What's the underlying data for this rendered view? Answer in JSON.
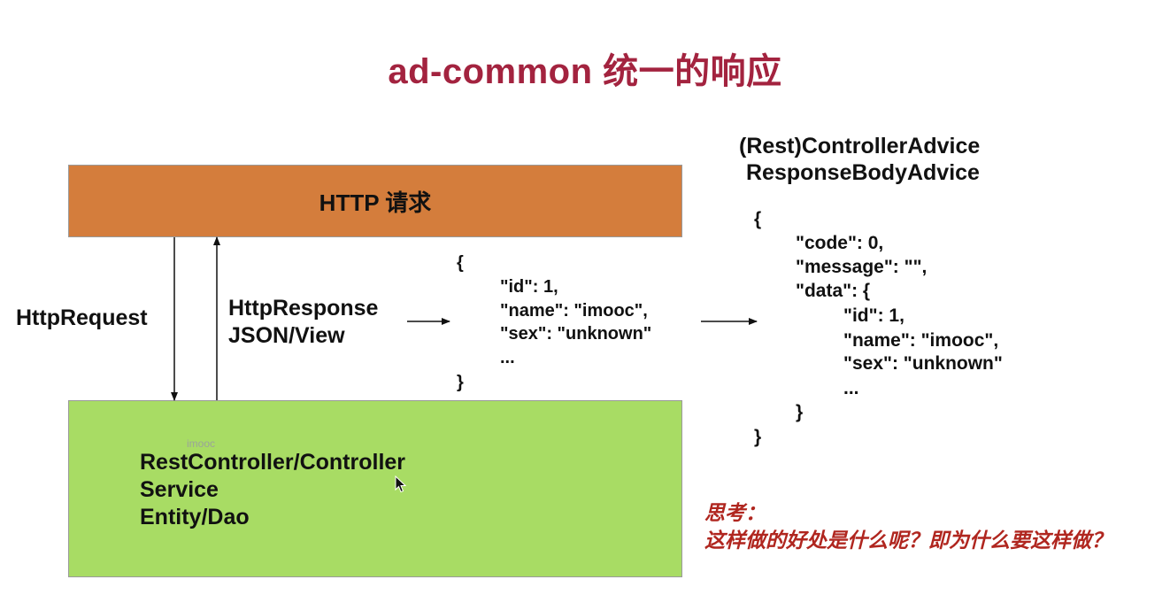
{
  "title": "ad-common 统一的响应",
  "http_box": {
    "label": "HTTP 请求",
    "color": "#d47d3c"
  },
  "backend_box": {
    "color": "#a8dc64",
    "watermark": "imooc",
    "layers": [
      "RestController/Controller",
      "Service",
      "Entity/Dao"
    ]
  },
  "request_label": "HttpRequest",
  "response_labels": [
    "HttpResponse",
    "JSON/View"
  ],
  "raw_json": {
    "open": "{",
    "lines": [
      "\"id\": 1,",
      "\"name\": \"imooc\",",
      "\"sex\": \"unknown\"",
      "..."
    ],
    "close": "}"
  },
  "advice": {
    "line1": "(Rest)ControllerAdvice",
    "line2": "ResponseBodyAdvice"
  },
  "wrapped_json": {
    "open": "{",
    "code": "\"code\": 0,",
    "message": "\"message\": \"\",",
    "data_open": "\"data\": {",
    "data_lines": [
      "\"id\": 1,",
      "\"name\": \"imooc\",",
      "\"sex\": \"unknown\"",
      "..."
    ],
    "data_close": "}",
    "close": "}"
  },
  "thinking": {
    "label": "思考：",
    "question": "这样做的好处是什么呢？即为什么要这样做？",
    "color": "#b0261f"
  },
  "icons": {
    "cursor": "mouse-pointer-icon"
  }
}
